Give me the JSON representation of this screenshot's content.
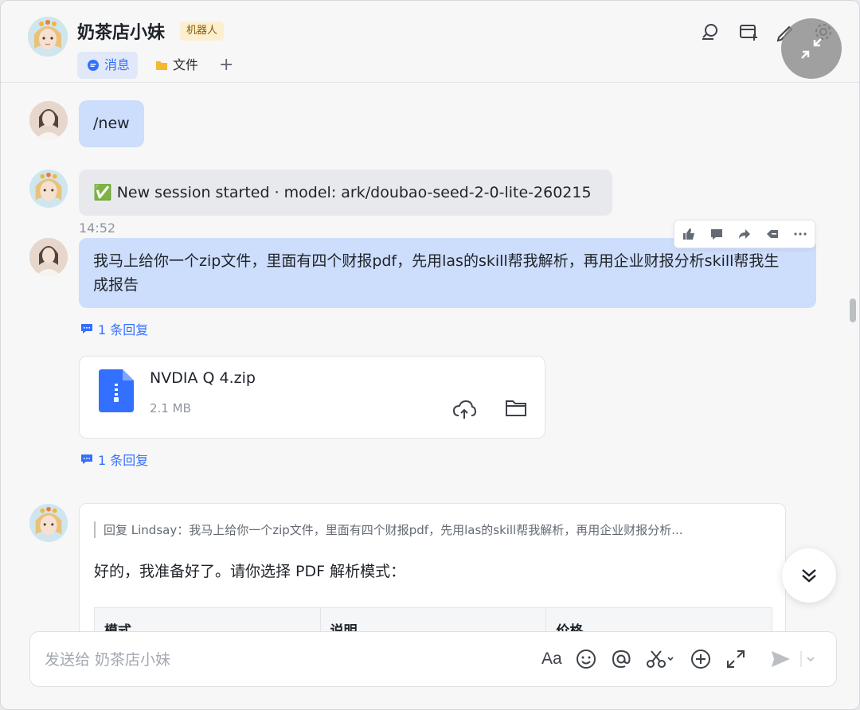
{
  "header": {
    "title": "奶茶店小妹",
    "badge": "机器人",
    "tabs": [
      {
        "label": "消息",
        "icon": "chat-bubble-icon",
        "active": true
      },
      {
        "label": "文件",
        "icon": "folder-icon",
        "active": false
      }
    ],
    "add_tab": "+"
  },
  "messages": {
    "m1_text": "/new",
    "m2_text": "✅ New session started · model: ark/doubao-seed-2-0-lite-260215",
    "time": "14:52",
    "m3_text": "我马上给你一个zip文件，里面有四个财报pdf，先用las的skill帮我解析，再用企业财报分析skill帮我生成报告",
    "reply_count_1": "1 条回复",
    "file": {
      "name": "NVDIA Q 4.zip",
      "size": "2.1 MB"
    },
    "reply_count_2": "1 条回复",
    "reply": {
      "quote": "回复 Lindsay：我马上给你一个zip文件，里面有四个财报pdf，先用las的skill帮我解析，再用企业财报分析...",
      "text": "好的，我准备好了。请你选择 PDF 解析模式：",
      "table_headers": [
        "模式",
        "说明",
        "价格"
      ]
    }
  },
  "composer": {
    "placeholder": "发送给 奶茶店小妹",
    "font_label": "Aa"
  },
  "colors": {
    "accent": "#3370ff",
    "user_bubble": "#cdddfc",
    "bot_bubble": "#e8e9ed"
  }
}
